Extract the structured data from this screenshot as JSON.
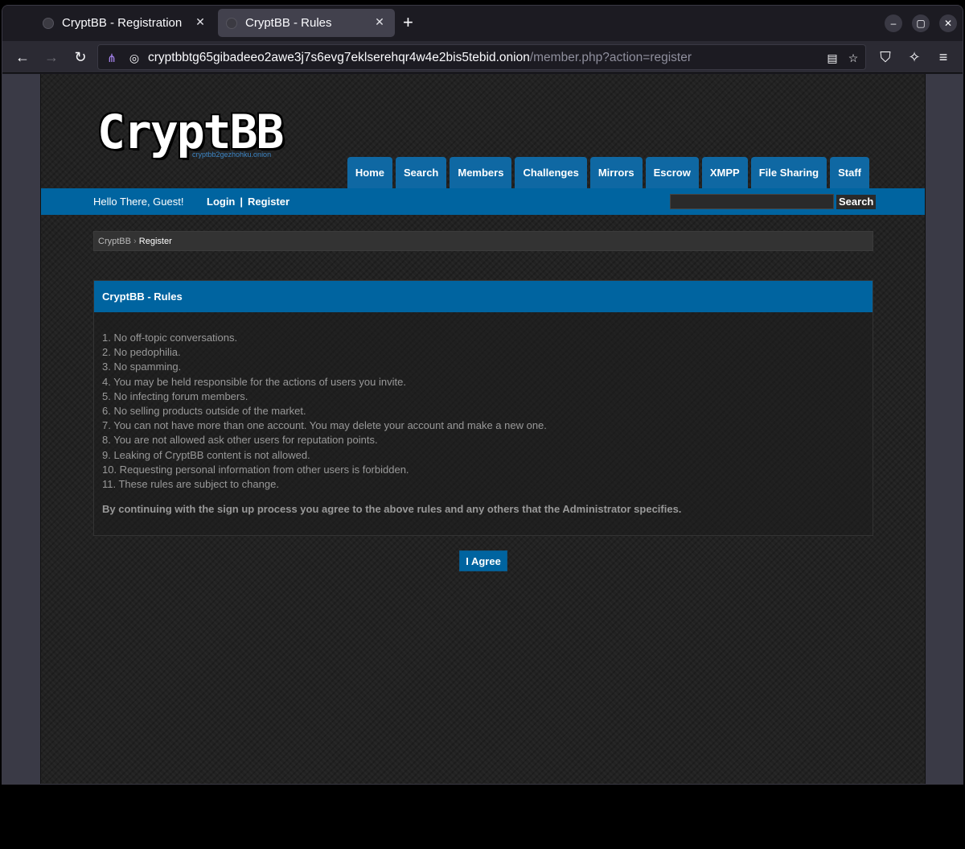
{
  "browser": {
    "tabs": [
      {
        "title": "CryptBB - Registration",
        "active": false
      },
      {
        "title": "CryptBB - Rules",
        "active": true
      }
    ],
    "new_tab_icon": "plus-icon",
    "url_host": "cryptbbtg65gibadeeo2awe3j7s6evg7eklserehqr4w4e2bis5tebid.onion",
    "url_path": "/member.php?action=register",
    "window_controls": [
      "minimize-icon",
      "maximize-icon",
      "close-icon"
    ]
  },
  "site": {
    "logo_text": "CryptBB",
    "logo_sub": "cryptbb2gezhohku.onion",
    "menu": [
      "Home",
      "Search",
      "Members",
      "Challenges",
      "Mirrors",
      "Escrow",
      "XMPP",
      "File Sharing",
      "Staff"
    ],
    "greeting": "Hello There, Guest!",
    "login": "Login",
    "separator": "|",
    "register": "Register",
    "search_button": "Search",
    "search_value": "",
    "accent_color": "#0064a0"
  },
  "breadcrumb": {
    "root": "CryptBB",
    "sep": "›",
    "current": "Register"
  },
  "rules_panel": {
    "title": "CryptBB - Rules",
    "rules": [
      "1. No off-topic conversations.",
      "2. No pedophilia.",
      "3. No spamming.",
      "4. You may be held responsible for the actions of users you invite.",
      "5. No infecting forum members.",
      "6. No selling products outside of the market.",
      "7. You can not have more than one account. You may delete your account and make a new one.",
      "8. You are not allowed ask other users for reputation points.",
      "9. Leaking of CryptBB content is not allowed.",
      "10. Requesting personal information from other users is forbidden.",
      "11. These rules are subject to change."
    ],
    "agreement": "By continuing with the sign up process you agree to the above rules and any others that the Administrator specifies.",
    "agree_button": "I Agree"
  }
}
